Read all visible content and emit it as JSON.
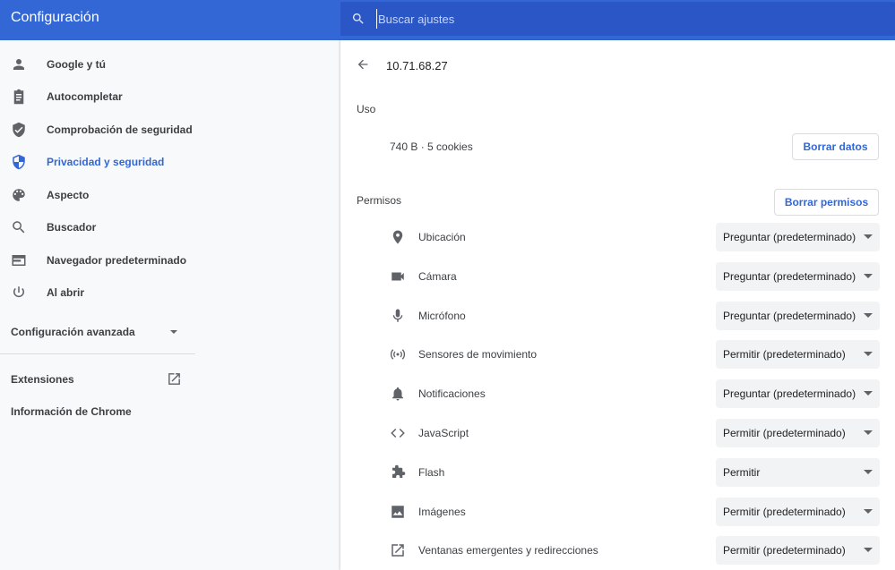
{
  "header": {
    "title": "Configuración",
    "search_placeholder": "Buscar ajustes"
  },
  "sidebar": {
    "items": [
      {
        "label": "Google y tú",
        "icon": "person-icon"
      },
      {
        "label": "Autocompletar",
        "icon": "clipboard-icon"
      },
      {
        "label": "Comprobación de seguridad",
        "icon": "shield-check-icon"
      },
      {
        "label": "Privacidad y seguridad",
        "icon": "shield-icon",
        "active": true
      },
      {
        "label": "Aspecto",
        "icon": "palette-icon"
      },
      {
        "label": "Buscador",
        "icon": "search-icon"
      },
      {
        "label": "Navegador predeterminado",
        "icon": "browser-icon"
      },
      {
        "label": "Al abrir",
        "icon": "power-icon"
      }
    ],
    "advanced": "Configuración avanzada",
    "extensions": "Extensiones",
    "about": "Información de Chrome"
  },
  "main": {
    "site": "10.71.68.27",
    "usage_title": "Uso",
    "usage": "740 B · 5 cookies",
    "clear_data": "Borrar datos",
    "permissions_title": "Permisos",
    "clear_permissions": "Borrar permisos",
    "permissions": [
      {
        "label": "Ubicación",
        "value": "Preguntar (predeterminado)",
        "icon": "location-icon"
      },
      {
        "label": "Cámara",
        "value": "Preguntar (predeterminado)",
        "icon": "camera-icon"
      },
      {
        "label": "Micrófono",
        "value": "Preguntar (predeterminado)",
        "icon": "microphone-icon"
      },
      {
        "label": "Sensores de movimiento",
        "value": "Permitir (predeterminado)",
        "icon": "sensors-icon"
      },
      {
        "label": "Notificaciones",
        "value": "Preguntar (predeterminado)",
        "icon": "bell-icon"
      },
      {
        "label": "JavaScript",
        "value": "Permitir (predeterminado)",
        "icon": "code-icon"
      },
      {
        "label": "Flash",
        "value": "Permitir",
        "icon": "puzzle-icon"
      },
      {
        "label": "Imágenes",
        "value": "Permitir (predeterminado)",
        "icon": "image-icon"
      },
      {
        "label": "Ventanas emergentes y redirecciones",
        "value": "Permitir (predeterminado)",
        "icon": "open-in-new-icon"
      }
    ]
  }
}
